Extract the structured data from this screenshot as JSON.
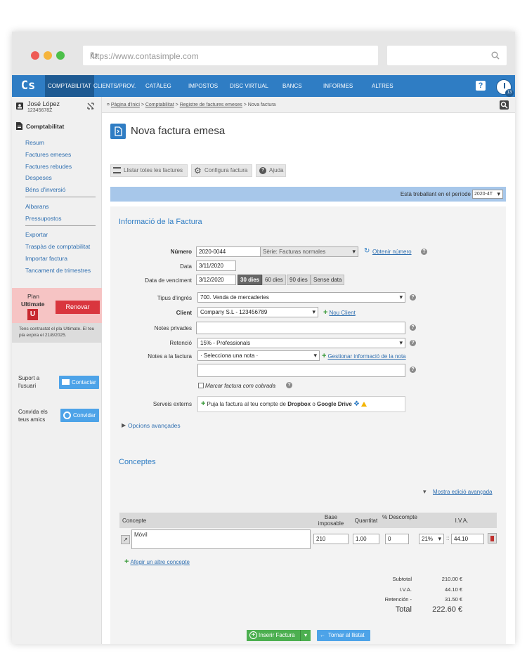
{
  "browser": {
    "url": "https://www.contasimple.com",
    "search_placeholder": ""
  },
  "nav": {
    "logo": "Cs",
    "items": [
      "COMPTABILITAT",
      "CLIENTS/PROV.",
      "CATÀLEG",
      "IMPOSTOS",
      "DISC VIRTUAL",
      "BANCS",
      "INFORMES",
      "ALTRES"
    ],
    "help": "?",
    "notifications": "13"
  },
  "user": {
    "name": "José López",
    "nif": "12345678Z"
  },
  "breadcrumb": {
    "home": "Pàgina d'inici",
    "section": "Comptabilitat",
    "list": "Registre de factures emeses",
    "current": "Nova factura"
  },
  "sidebar": {
    "title": "Comptabilitat",
    "group1": [
      "Resum",
      "Factures emeses",
      "Factures rebudes",
      "Despeses",
      "Béns d'inversió"
    ],
    "group2": [
      "Albarans",
      "Pressupostos"
    ],
    "group3": [
      "Exportar",
      "Traspàs de comptabilitat",
      "Importar factura",
      "Tancament de trimestres"
    ],
    "plan_label": "Plan",
    "plan_name": "Ultimate",
    "plan_badge": "U",
    "renew": "Renovar",
    "plan_note": "Tens contractat el pla Ultimate. El teu pla expira el 21/8/2025.",
    "support_label": "Suport a l'usuari",
    "contact": "Contactar",
    "invite_label": "Convida els teus amics",
    "invite": "Convidar"
  },
  "page": {
    "title": "Nova factura emesa",
    "tools": [
      "Llistar totes les factures",
      "Configura factura",
      "Ajuda"
    ],
    "period_label": "Està treballant en el període",
    "period_value": "2020-4T"
  },
  "info": {
    "title": "Informació de la Factura",
    "numero_label": "Número",
    "numero_value": "2020-0044",
    "serie_value": "Sèrie: Facturas normales",
    "obtenir": "Obtenir número",
    "data_label": "Data",
    "data_value": "3/11/2020",
    "venciment_label": "Data de venciment",
    "venciment_value": "3/12/2020",
    "venciment_options": [
      "30 dies",
      "60 dies",
      "90 dies",
      "Sense data"
    ],
    "tipus_label": "Tipus d'ingrés",
    "tipus_value": "700. Venda de mercaderies",
    "client_label": "Client",
    "client_value": "Company S.L - 123456789",
    "nou_client": "Nou Client",
    "notes_privades_label": "Notes privades",
    "retencio_label": "Retenció",
    "retencio_value": "15% - Professionals",
    "notes_factura_label": "Notes a la factura",
    "notes_factura_value": "· Selecciona una nota ·",
    "gestionar": "Gestionar informació de la nota",
    "cobrada": "Marcar factura com cobrada",
    "serveis_label": "Serveis externs",
    "serveis_text": "Puja la factura al teu compte de",
    "dropbox": "Dropbox",
    "o": "o",
    "gdrive": "Google Drive",
    "opcions": "Opcions avançades"
  },
  "concepts": {
    "title": "Conceptes",
    "advanced": "Mostra edició avançada",
    "headers": [
      "Concepte",
      "Base imposable",
      "Quantitat",
      "% Descompte",
      "I.V.A."
    ],
    "row": {
      "concept": "Móvil",
      "base": "210",
      "qty": "1.00",
      "disc": "0",
      "iva_rate": "21%",
      "iva_amount": "44.10"
    },
    "add": "Afegir un altre concepte"
  },
  "totals": {
    "subtotal_label": "Subtotal",
    "subtotal": "210.00 €",
    "iva_label": "I.V.A.",
    "iva": "44.10 €",
    "retencio_label": "Retención -",
    "retencio": "31.50 €",
    "total_label": "Total",
    "total": "222.60 €"
  },
  "actions": {
    "insert": "Inserir Factura",
    "back": "Tornar al llistat"
  },
  "colors": {
    "nav": "#2f7dc4",
    "nav_active": "#1e5a92",
    "accent": "#2f7dc4",
    "plan_bg": "#f6c4c4",
    "renew": "#d9363e",
    "green": "#4caf50"
  }
}
